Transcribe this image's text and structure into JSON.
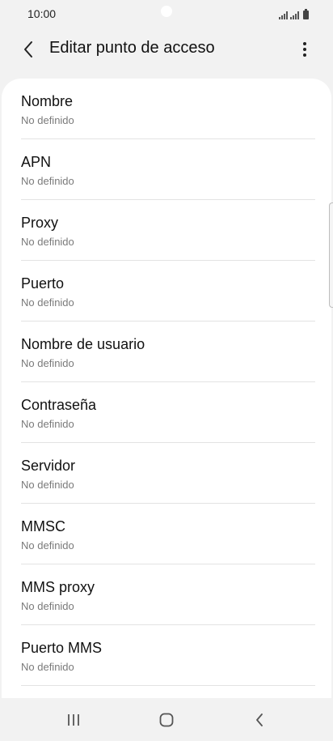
{
  "status_bar": {
    "time": "10:00"
  },
  "app_bar": {
    "title": "Editar punto de acceso",
    "back_icon": "chevron-left-icon",
    "more_icon": "more-vertical-icon"
  },
  "items": [
    {
      "title": "Nombre",
      "value": "No definido"
    },
    {
      "title": "APN",
      "value": "No definido"
    },
    {
      "title": "Proxy",
      "value": "No definido"
    },
    {
      "title": "Puerto",
      "value": "No definido"
    },
    {
      "title": "Nombre de usuario",
      "value": "No definido"
    },
    {
      "title": "Contraseña",
      "value": "No definido"
    },
    {
      "title": "Servidor",
      "value": "No definido"
    },
    {
      "title": "MMSC",
      "value": "No definido"
    },
    {
      "title": "MMS proxy",
      "value": "No definido"
    },
    {
      "title": "Puerto MMS",
      "value": "No definido"
    }
  ],
  "nav_bar": {
    "recent_icon": "recent-apps-icon",
    "home_icon": "home-icon",
    "back_icon": "back-icon"
  },
  "colors": {
    "background": "#f2f2f2",
    "card": "#ffffff",
    "secondary_text": "#7a7a7a",
    "divider": "#e3e3e3"
  }
}
